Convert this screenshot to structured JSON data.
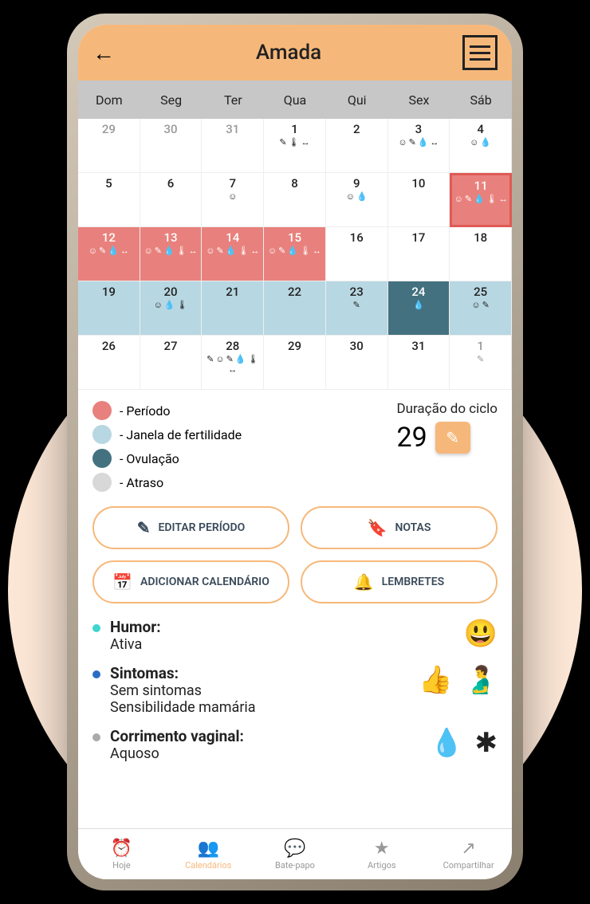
{
  "header": {
    "title": "Amada"
  },
  "weekdays": [
    "Dom",
    "Seg",
    "Ter",
    "Qua",
    "Qui",
    "Sex",
    "Sáb"
  ],
  "calendar": [
    {
      "num": "29",
      "cls": "gray",
      "icons": []
    },
    {
      "num": "30",
      "cls": "gray",
      "icons": []
    },
    {
      "num": "31",
      "cls": "gray",
      "icons": []
    },
    {
      "num": "1",
      "cls": "",
      "icons": [
        "✎",
        "🌡",
        "↔"
      ]
    },
    {
      "num": "2",
      "cls": "",
      "icons": []
    },
    {
      "num": "3",
      "cls": "",
      "icons": [
        "☺",
        "✎",
        "💧",
        "↔"
      ]
    },
    {
      "num": "4",
      "cls": "",
      "icons": [
        "☺",
        "💧"
      ]
    },
    {
      "num": "5",
      "cls": "",
      "icons": []
    },
    {
      "num": "6",
      "cls": "",
      "icons": []
    },
    {
      "num": "7",
      "cls": "",
      "icons": [
        "☺"
      ]
    },
    {
      "num": "8",
      "cls": "",
      "icons": []
    },
    {
      "num": "9",
      "cls": "",
      "icons": [
        "☺",
        "💧"
      ]
    },
    {
      "num": "10",
      "cls": "",
      "icons": []
    },
    {
      "num": "11",
      "cls": "period-selected",
      "icons": [
        "☺",
        "✎",
        "💧",
        "🌡",
        "↔"
      ]
    },
    {
      "num": "12",
      "cls": "period",
      "icons": [
        "☺",
        "✎",
        "💧",
        "↔"
      ]
    },
    {
      "num": "13",
      "cls": "period",
      "icons": [
        "☺",
        "✎",
        "💧",
        "🌡",
        "↔"
      ]
    },
    {
      "num": "14",
      "cls": "period",
      "icons": [
        "☺",
        "✎",
        "💧",
        "🌡",
        "↔"
      ]
    },
    {
      "num": "15",
      "cls": "period",
      "icons": [
        "☺",
        "✎",
        "💧",
        "🌡",
        "↔"
      ]
    },
    {
      "num": "16",
      "cls": "",
      "icons": []
    },
    {
      "num": "17",
      "cls": "",
      "icons": []
    },
    {
      "num": "18",
      "cls": "",
      "icons": []
    },
    {
      "num": "19",
      "cls": "fertility",
      "icons": []
    },
    {
      "num": "20",
      "cls": "fertility",
      "icons": [
        "☺",
        "💧",
        "🌡"
      ]
    },
    {
      "num": "21",
      "cls": "fertility",
      "icons": []
    },
    {
      "num": "22",
      "cls": "fertility",
      "icons": []
    },
    {
      "num": "23",
      "cls": "fertility",
      "icons": [
        "✎"
      ]
    },
    {
      "num": "24",
      "cls": "ovulation",
      "icons": [
        "💧"
      ]
    },
    {
      "num": "25",
      "cls": "fertility",
      "icons": [
        "☺",
        "✎"
      ]
    },
    {
      "num": "26",
      "cls": "",
      "icons": []
    },
    {
      "num": "27",
      "cls": "",
      "icons": []
    },
    {
      "num": "28",
      "cls": "",
      "icons": [
        "✎",
        "☺",
        "✎",
        "💧",
        "🌡",
        "↔"
      ]
    },
    {
      "num": "29",
      "cls": "",
      "icons": []
    },
    {
      "num": "30",
      "cls": "",
      "icons": []
    },
    {
      "num": "31",
      "cls": "",
      "icons": []
    },
    {
      "num": "1",
      "cls": "gray",
      "icons": [
        "✎"
      ]
    }
  ],
  "legend": {
    "period": "- Período",
    "fertility": "- Janela de fertilidade",
    "ovulation": "- Ovulação",
    "late": "- Atraso"
  },
  "cycle": {
    "label": "Duração do ciclo",
    "value": "29"
  },
  "actions": {
    "edit_period": "EDITAR PERÍODO",
    "notes": "NOTAS",
    "add_calendar": "ADICIONAR CALENDÁRIO",
    "reminders": "LEMBRETES"
  },
  "details": {
    "mood_label": "Humor:",
    "mood_value": "Ativa",
    "symptoms_label": "Sintomas:",
    "symptoms_value1": "Sem sintomas",
    "symptoms_value2": "Sensibilidade mamária",
    "discharge_label": "Corrimento vaginal:",
    "discharge_value": "Aquoso"
  },
  "nav": {
    "today": "Hoje",
    "calendars": "Calendários",
    "chat": "Bate-papo",
    "articles": "Artigos",
    "share": "Compartilhar"
  }
}
